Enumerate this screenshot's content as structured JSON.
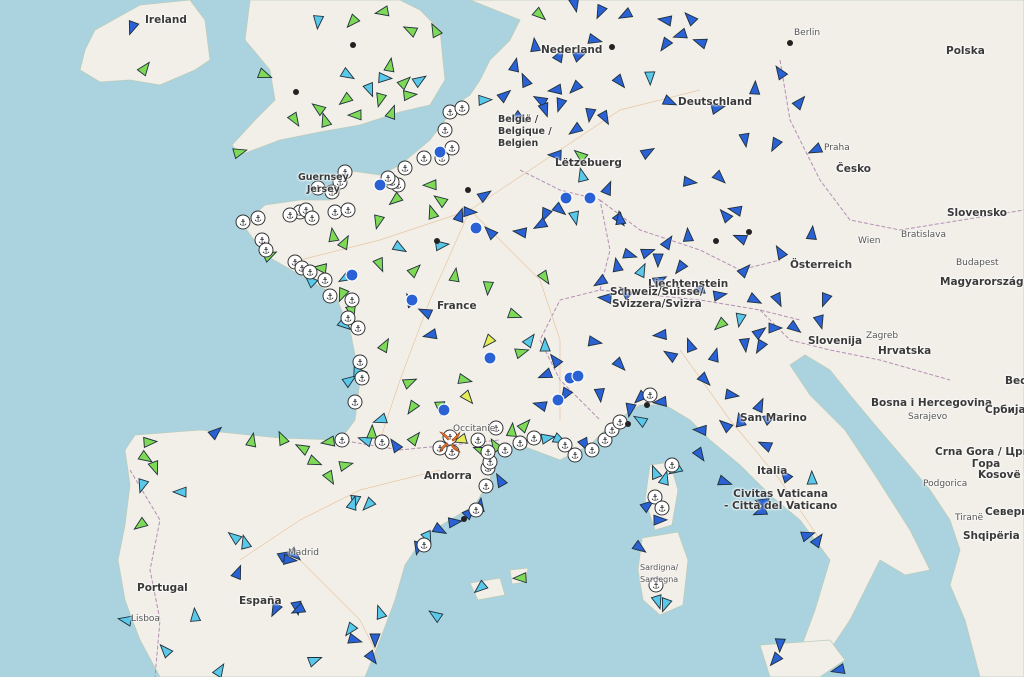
{
  "labels": {
    "ireland": "Ireland",
    "nederland": "Nederland",
    "berlin": "Berlin",
    "polska": "Polska",
    "deutschland": "Deutschland",
    "belgie": "België / Belgique / Belgien",
    "letzebuerg": "Lëtzebuerg",
    "praha": "Praha",
    "cesko": "Česko",
    "slovensko": "Slovensko",
    "wien": "Wien",
    "bratislava": "Bratislava",
    "osterreich": "Österreich",
    "budapest": "Budapest",
    "magyarorszag": "Magyarország",
    "liechtenstein": "Liechtenstein",
    "schweiz": "Schweiz/Suisse/\nSvizzera/Svizra",
    "france": "France",
    "slovenija": "Slovenija",
    "zagreb": "Zagreb",
    "hrvatska": "Hrvatska",
    "bosna": "Bosna i Hercegovina",
    "srbija": "Србија",
    "sarajevo": "Sarajevo",
    "san_marino": "San Marino",
    "italia": "Italia",
    "civitas": "Civitas Vaticana\n- Città del Vaticano",
    "crna_gora": "Crna Gora / Црна\nГора",
    "kosove": "Kosovë / K",
    "podgorica": "Podgorica",
    "severna": "Северна",
    "shqiperia": "Shqipëria",
    "tirane": "Tiranë",
    "andorra": "Andorra",
    "portugal": "Portugal",
    "espana": "España",
    "madrid": "Madrid",
    "lisboa": "Lisboa",
    "guernsey": "Guernsey\nJersey",
    "occitanie": "Occitanie",
    "sardigna": "Sardigna/\nSardegna",
    "bel": "Beo"
  },
  "colors": {
    "sea": "#aad3df",
    "land": "#f2efe9",
    "green_marker": "#7ed957",
    "blue_marker": "#2a62d6",
    "cyan_marker": "#5ac8e8",
    "port_marker": "#ffffff"
  },
  "marker_types": [
    "green-arrow",
    "blue-arrow",
    "cyan-arrow",
    "anchor-port",
    "black-dot",
    "cyclone"
  ]
}
